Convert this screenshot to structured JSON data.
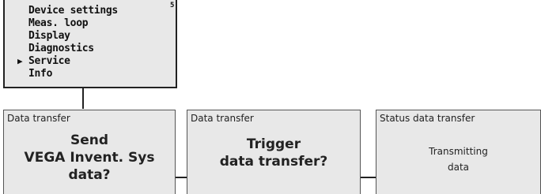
{
  "menu": {
    "page_number": "5",
    "items": [
      {
        "label": "Device settings"
      },
      {
        "label": "Meas. loop"
      },
      {
        "label": "Display"
      },
      {
        "label": "Diagnostics"
      },
      {
        "label": "Service"
      },
      {
        "label": "Info"
      }
    ],
    "selected_index": 4,
    "cursor": "▶"
  },
  "panels": [
    {
      "header": "Data transfer",
      "body": "Send\nVEGA Invent. Sys\ndata?"
    },
    {
      "header": "Data transfer",
      "body": "Trigger\ndata transfer?"
    },
    {
      "header": "Status data transfer",
      "body": "Transmitting\ndata"
    }
  ]
}
